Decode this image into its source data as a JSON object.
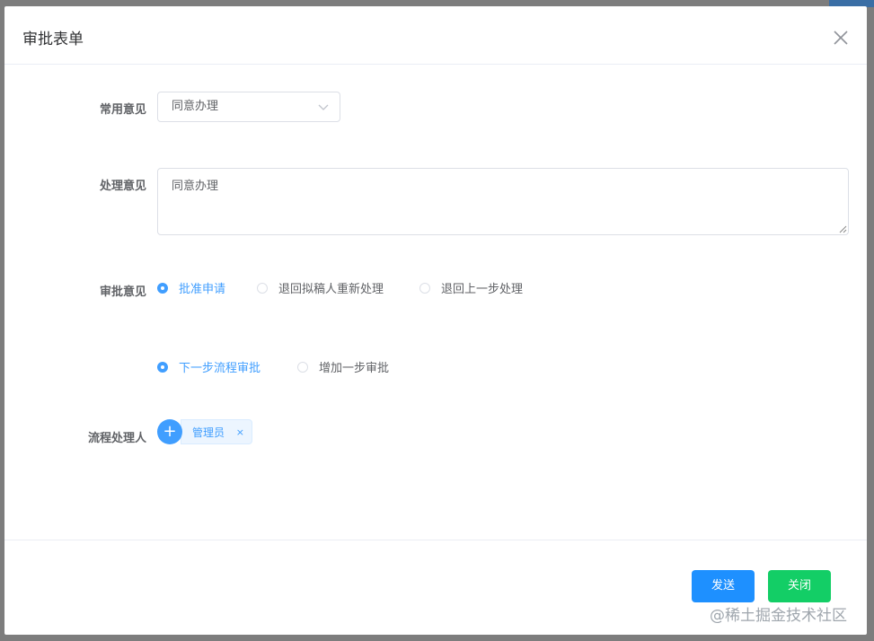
{
  "dialog": {
    "title": "审批表单"
  },
  "form": {
    "common_opinion": {
      "label": "常用意见",
      "selected": "同意办理"
    },
    "handling_opinion": {
      "label": "处理意见",
      "value": "同意办理"
    },
    "approval_opinion": {
      "label": "审批意见",
      "options": [
        {
          "label": "批准申请",
          "checked": true
        },
        {
          "label": "退回拟稿人重新处理",
          "checked": false
        },
        {
          "label": "退回上一步处理",
          "checked": false
        }
      ]
    },
    "next_step": {
      "options": [
        {
          "label": "下一步流程审批",
          "checked": true
        },
        {
          "label": "增加一步审批",
          "checked": false
        }
      ]
    },
    "process_handler": {
      "label": "流程处理人",
      "add_symbol": "+",
      "tags": [
        {
          "label": "管理员",
          "close": "×"
        }
      ]
    }
  },
  "footer": {
    "send_label": "发送",
    "close_label": "关闭"
  },
  "watermark": "@稀土掘金技术社区",
  "colors": {
    "primary": "#409eff",
    "send": "#1e90ff",
    "close": "#13ce66",
    "overlay": "#7d7d7d"
  },
  "icons": {
    "close": "close-icon",
    "dropdown": "chevron-down-icon",
    "add": "plus-icon",
    "tag_remove": "close-icon"
  }
}
